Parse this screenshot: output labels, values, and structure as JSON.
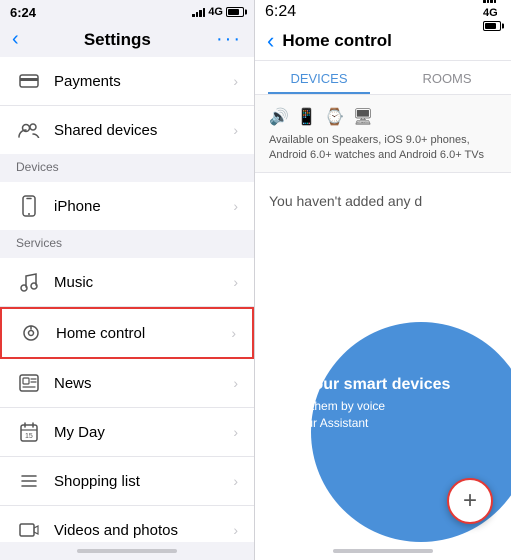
{
  "left": {
    "statusBar": {
      "time": "6:24",
      "network": "4G"
    },
    "nav": {
      "backLabel": "‹",
      "title": "Settings",
      "moreIcon": "···"
    },
    "sections": [
      {
        "label": "",
        "items": [
          {
            "id": "payments",
            "icon": "💳",
            "label": "Payments",
            "highlighted": false
          },
          {
            "id": "shared-devices",
            "icon": "👥",
            "label": "Shared devices",
            "highlighted": false
          }
        ]
      },
      {
        "label": "Devices",
        "items": [
          {
            "id": "iphone",
            "icon": "📱",
            "label": "iPhone",
            "highlighted": false
          }
        ]
      },
      {
        "label": "Services",
        "items": [
          {
            "id": "music",
            "icon": "♪",
            "label": "Music",
            "highlighted": false
          },
          {
            "id": "home-control",
            "icon": "💡",
            "label": "Home control",
            "highlighted": true
          },
          {
            "id": "news",
            "icon": "📰",
            "label": "News",
            "highlighted": false
          },
          {
            "id": "my-day",
            "icon": "📅",
            "label": "My Day",
            "highlighted": false
          },
          {
            "id": "shopping-list",
            "icon": "≡",
            "label": "Shopping list",
            "highlighted": false
          },
          {
            "id": "videos-photos",
            "icon": "🎬",
            "label": "Videos and photos",
            "highlighted": false
          }
        ]
      }
    ]
  },
  "right": {
    "statusBar": {
      "time": "6:24",
      "network": "4G"
    },
    "nav": {
      "backIcon": "‹",
      "title": "Home control"
    },
    "tabs": [
      {
        "id": "devices",
        "label": "DEVICES",
        "active": true
      },
      {
        "id": "rooms",
        "label": "ROOMS",
        "active": false
      }
    ],
    "devicesInfo": {
      "description": "Available on Speakers, iOS 9.0+ phones, Android 6.0+ watches and Android 6.0+ TVs"
    },
    "emptyMessage": "You haven't added any d",
    "addDevicesTitle": "Add your smart devices",
    "addDevicesSubtitle": "Control them by voice\nwith your Assistant",
    "fabIcon": "+"
  }
}
